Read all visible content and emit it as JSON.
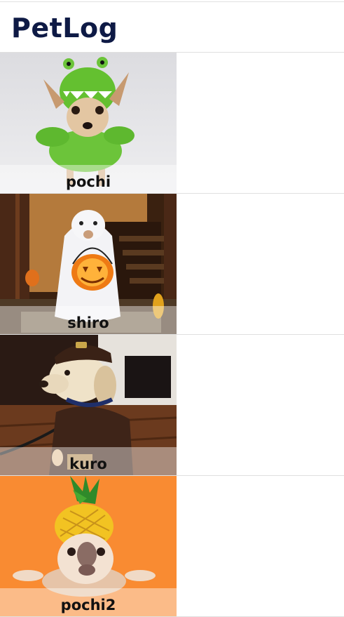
{
  "app": {
    "title": "PetLog"
  },
  "pets": [
    {
      "name": "pochi",
      "photo_icon": "dog-in-green-dinosaur-costume"
    },
    {
      "name": "shiro",
      "photo_icon": "dog-in-ghost-costume-with-pumpkin"
    },
    {
      "name": "kuro",
      "photo_icon": "dog-in-ups-uniform"
    },
    {
      "name": "pochi2",
      "photo_icon": "dog-in-pineapple-costume"
    }
  ],
  "colors": {
    "title": "#0e1a45",
    "divider": "#e0e0e0"
  }
}
